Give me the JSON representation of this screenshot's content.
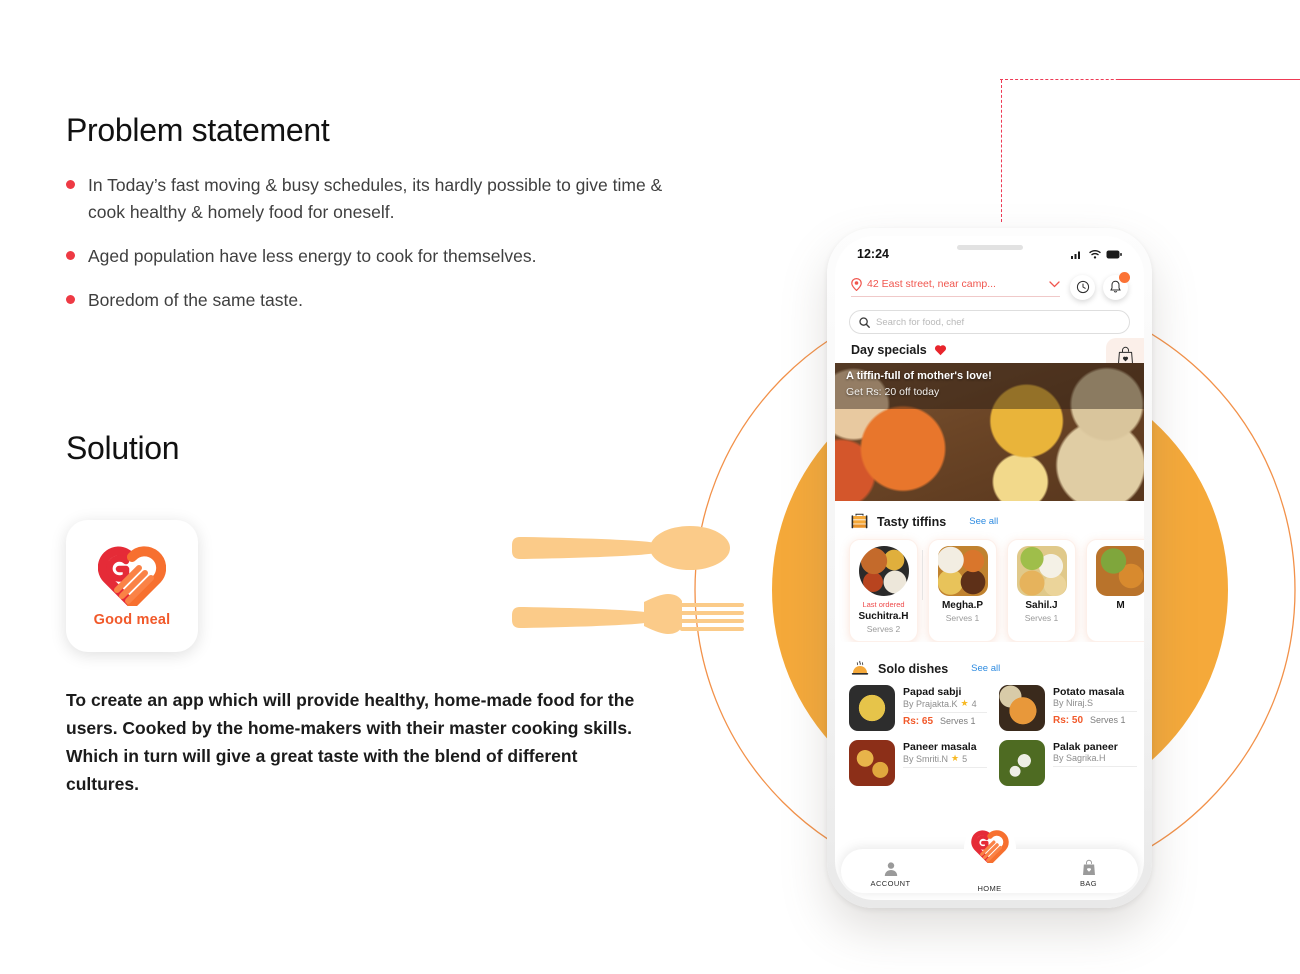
{
  "left": {
    "problem_heading": "Problem statement",
    "problem_points": [
      "In Today’s fast moving & busy schedules, its hardly possible to give time & cook healthy & homely food for oneself.",
      "Aged population have less energy to cook for themselves.",
      "Boredom of the same taste."
    ],
    "solution_heading": "Solution",
    "logo_word": "Good meal",
    "solution_body": "To create an app which will provide healthy, home-made food for the users. Cooked by the home-makers with their master cooking skills. Which in turn will give a great taste with the blend of different cultures."
  },
  "colors": {
    "bullet_red": "#EE3A44",
    "brand_orange": "#F1592A",
    "accent_amber": "#F5A93A",
    "cutlery": "#FBCB89",
    "dashed_line": "#EE3A55",
    "link_blue": "#2E8BE0",
    "notification": "#FB7235",
    "star_yellow": "#F7B924"
  },
  "phone": {
    "status": {
      "time": "12:24"
    },
    "header": {
      "address": "42 East street, near camp...",
      "location_icon": "map-pin-icon",
      "chevron_icon": "chevron-down-icon",
      "history_icon": "clock-history-icon",
      "bell_icon": "bell-icon"
    },
    "search": {
      "placeholder": "Search for food, chef",
      "icon": "search-icon"
    },
    "day_specials": {
      "title": "Day specials",
      "heart_icon": "heart-icon",
      "bag_icon": "bag-heart-icon"
    },
    "banner": {
      "line1": "A tiffin-full of mother's love!",
      "line2": "Get Rs: 20 off today"
    },
    "tiffins": {
      "title": "Tasty tiffins",
      "icon": "tiffin-box-icon",
      "see_all": "See all",
      "cards": [
        {
          "badge": "Last ordered",
          "name": "Suchitra.H",
          "serves": "Serves 2"
        },
        {
          "badge": "",
          "name": "Megha.P",
          "serves": "Serves 1"
        },
        {
          "badge": "",
          "name": "Sahil.J",
          "serves": "Serves 1"
        },
        {
          "badge": "",
          "name": "M",
          "serves": ""
        }
      ]
    },
    "solo": {
      "title": "Solo dishes",
      "icon": "food-dome-icon",
      "see_all": "See all",
      "dishes": [
        {
          "name": "Papad sabji",
          "by": "By Prajakta.K",
          "rating": "4",
          "price": "Rs: 65",
          "serves": "Serves 1"
        },
        {
          "name": "Potato masala",
          "by": "By Niraj.S",
          "rating": "",
          "price": "Rs: 50",
          "serves": "Serves 1"
        },
        {
          "name": "Paneer masala",
          "by": "By Smriti.N",
          "rating": "5",
          "price": "",
          "serves": ""
        },
        {
          "name": "Palak paneer",
          "by": "By Sagrika.H",
          "rating": "",
          "price": "",
          "serves": ""
        }
      ]
    },
    "bottom_nav": [
      {
        "label": "ACCOUNT",
        "icon": "person-icon"
      },
      {
        "label": "HOME",
        "icon": "good-meal-logo-icon"
      },
      {
        "label": "BAG",
        "icon": "bag-heart-icon"
      }
    ]
  }
}
